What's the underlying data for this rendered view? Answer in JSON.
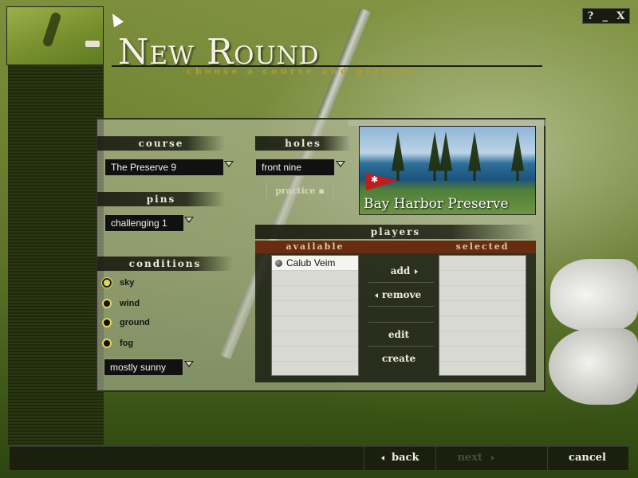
{
  "window_controls": {
    "help": "?",
    "minimize": "_",
    "close": "X"
  },
  "header": {
    "title": "New Round",
    "subtitle": "choose a course and players"
  },
  "course": {
    "section_label": "course",
    "selected": "The Preserve 9",
    "photo_caption": "Bay Harbor Preserve"
  },
  "holes": {
    "section_label": "holes",
    "selected": "front nine",
    "practice_label": "practice"
  },
  "pins": {
    "section_label": "pins",
    "selected": "challenging 1"
  },
  "conditions": {
    "section_label": "conditions",
    "options": [
      {
        "label": "sky",
        "selected": true
      },
      {
        "label": "wind",
        "selected": false
      },
      {
        "label": "ground",
        "selected": false
      },
      {
        "label": "fog",
        "selected": false
      }
    ],
    "value": "mostly sunny"
  },
  "players": {
    "section_label": "players",
    "available_header": "available",
    "selected_header": "selected",
    "available": [
      "Calub Veim"
    ],
    "selected": [],
    "actions": {
      "add": "add",
      "remove": "remove",
      "edit": "edit",
      "create": "create"
    }
  },
  "footer": {
    "back": "back",
    "next": "next",
    "cancel": "cancel"
  },
  "colors": {
    "accent_gold": "#b79a2c",
    "radio_yellow": "#e2d65a",
    "players_header_bar": "#6a2c10",
    "flag_red": "#c21c1c"
  }
}
